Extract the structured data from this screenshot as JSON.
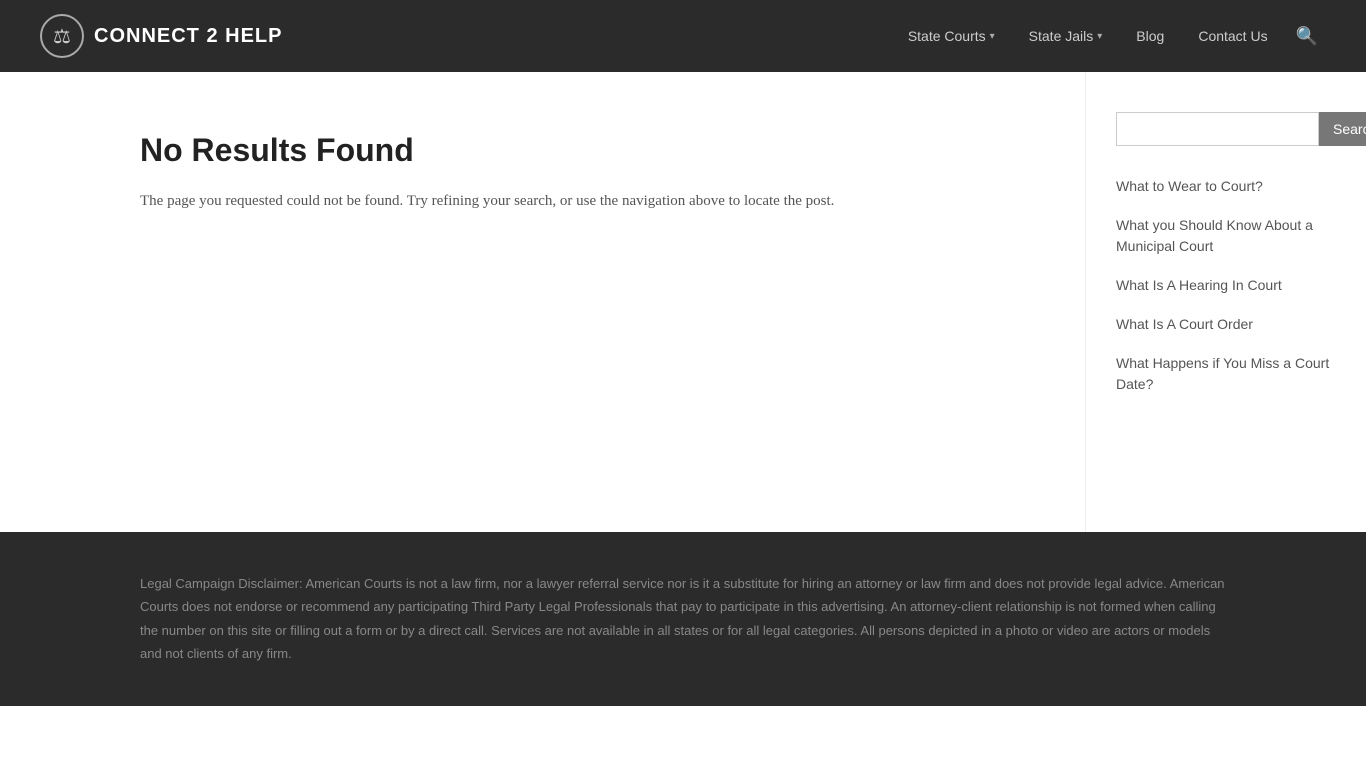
{
  "header": {
    "logo_text": "CONNECT 2 HELP",
    "logo_icon": "⚖",
    "nav": [
      {
        "label": "State Courts",
        "has_dropdown": true
      },
      {
        "label": "State Jails",
        "has_dropdown": true
      },
      {
        "label": "Blog",
        "has_dropdown": false
      },
      {
        "label": "Contact Us",
        "has_dropdown": false
      }
    ]
  },
  "main": {
    "title": "No Results Found",
    "description": "The page you requested could not be found. Try refining your search, or use the navigation above to locate the post."
  },
  "sidebar": {
    "search_placeholder": "",
    "search_button": "Search",
    "links": [
      {
        "label": "What to Wear to Court?"
      },
      {
        "label": "What you Should Know About a Municipal Court"
      },
      {
        "label": "What Is A Hearing In Court"
      },
      {
        "label": "What Is A Court Order"
      },
      {
        "label": "What Happens if You Miss a Court Date?"
      }
    ]
  },
  "footer": {
    "disclaimer": "Legal Campaign Disclaimer: American Courts is not a law firm, nor a lawyer referral service nor is it a substitute for hiring an attorney or law firm and does not provide legal advice. American Courts does not endorse or recommend any participating Third Party Legal Professionals that pay to participate in this advertising. An attorney-client relationship is not formed when calling the number on this site or filling out a form or by a direct call. Services are not available in all states or for all legal categories. All persons depicted in a photo or video are actors or models and not clients of any firm."
  }
}
